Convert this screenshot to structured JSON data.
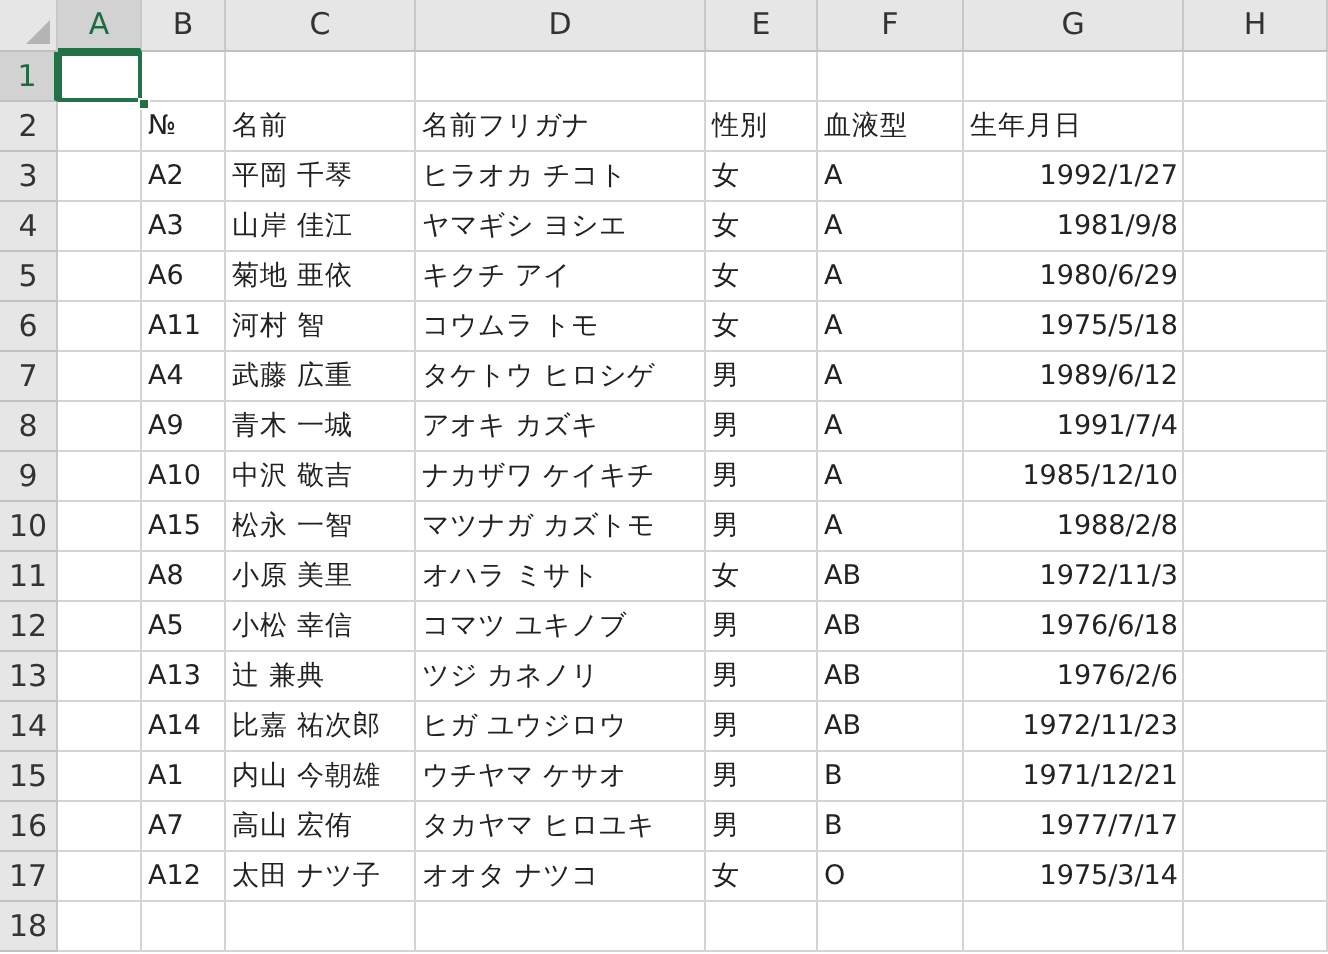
{
  "sheet": {
    "columns": [
      {
        "label": "A",
        "selected": true
      },
      {
        "label": "B",
        "selected": false
      },
      {
        "label": "C",
        "selected": false
      },
      {
        "label": "D",
        "selected": false
      },
      {
        "label": "E",
        "selected": false
      },
      {
        "label": "F",
        "selected": false
      },
      {
        "label": "G",
        "selected": false
      },
      {
        "label": "H",
        "selected": false
      }
    ],
    "rows": [
      {
        "number": "1",
        "selected": true
      },
      {
        "number": "2",
        "selected": false,
        "kind": "header",
        "cells": [
          "№",
          "名前",
          "名前フリガナ",
          "性別",
          "血液型",
          "生年月日"
        ]
      },
      {
        "number": "3",
        "selected": false,
        "kind": "data",
        "cells": [
          "A2",
          "平岡 千琴",
          "ヒラオカ チコト",
          "女",
          "A",
          "1992/1/27"
        ]
      },
      {
        "number": "4",
        "selected": false,
        "kind": "data",
        "cells": [
          "A3",
          "山岸 佳江",
          "ヤマギシ ヨシエ",
          "女",
          "A",
          "1981/9/8"
        ]
      },
      {
        "number": "5",
        "selected": false,
        "kind": "data",
        "cells": [
          "A6",
          "菊地 亜依",
          "キクチ アイ",
          "女",
          "A",
          "1980/6/29"
        ]
      },
      {
        "number": "6",
        "selected": false,
        "kind": "data",
        "cells": [
          "A11",
          "河村 智",
          "コウムラ トモ",
          "女",
          "A",
          "1975/5/18"
        ]
      },
      {
        "number": "7",
        "selected": false,
        "kind": "data",
        "cells": [
          "A4",
          "武藤 広重",
          "タケトウ ヒロシゲ",
          "男",
          "A",
          "1989/6/12"
        ]
      },
      {
        "number": "8",
        "selected": false,
        "kind": "data",
        "cells": [
          "A9",
          "青木 一城",
          "アオキ カズキ",
          "男",
          "A",
          "1991/7/4"
        ]
      },
      {
        "number": "9",
        "selected": false,
        "kind": "data",
        "cells": [
          "A10",
          "中沢 敬吉",
          "ナカザワ ケイキチ",
          "男",
          "A",
          "1985/12/10"
        ]
      },
      {
        "number": "10",
        "selected": false,
        "kind": "data",
        "cells": [
          "A15",
          "松永 一智",
          "マツナガ カズトモ",
          "男",
          "A",
          "1988/2/8"
        ]
      },
      {
        "number": "11",
        "selected": false,
        "kind": "data",
        "cells": [
          "A8",
          "小原 美里",
          "オハラ ミサト",
          "女",
          "AB",
          "1972/11/3"
        ]
      },
      {
        "number": "12",
        "selected": false,
        "kind": "data",
        "cells": [
          "A5",
          "小松 幸信",
          "コマツ ユキノブ",
          "男",
          "AB",
          "1976/6/18"
        ]
      },
      {
        "number": "13",
        "selected": false,
        "kind": "data",
        "cells": [
          "A13",
          "辻 兼典",
          "ツジ カネノリ",
          "男",
          "AB",
          "1976/2/6"
        ]
      },
      {
        "number": "14",
        "selected": false,
        "kind": "data",
        "cells": [
          "A14",
          "比嘉 祐次郎",
          "ヒガ ユウジロウ",
          "男",
          "AB",
          "1972/11/23"
        ]
      },
      {
        "number": "15",
        "selected": false,
        "kind": "data",
        "cells": [
          "A1",
          "内山 今朝雄",
          "ウチヤマ ケサオ",
          "男",
          "B",
          "1971/12/21"
        ]
      },
      {
        "number": "16",
        "selected": false,
        "kind": "data",
        "cells": [
          "A7",
          "高山 宏侑",
          "タカヤマ ヒロユキ",
          "男",
          "B",
          "1977/7/17"
        ]
      },
      {
        "number": "17",
        "selected": false,
        "kind": "data",
        "cells": [
          "A12",
          "太田 ナツ子",
          "オオタ ナツコ",
          "女",
          "O",
          "1975/3/14"
        ]
      },
      {
        "number": "18",
        "selected": false
      }
    ]
  }
}
